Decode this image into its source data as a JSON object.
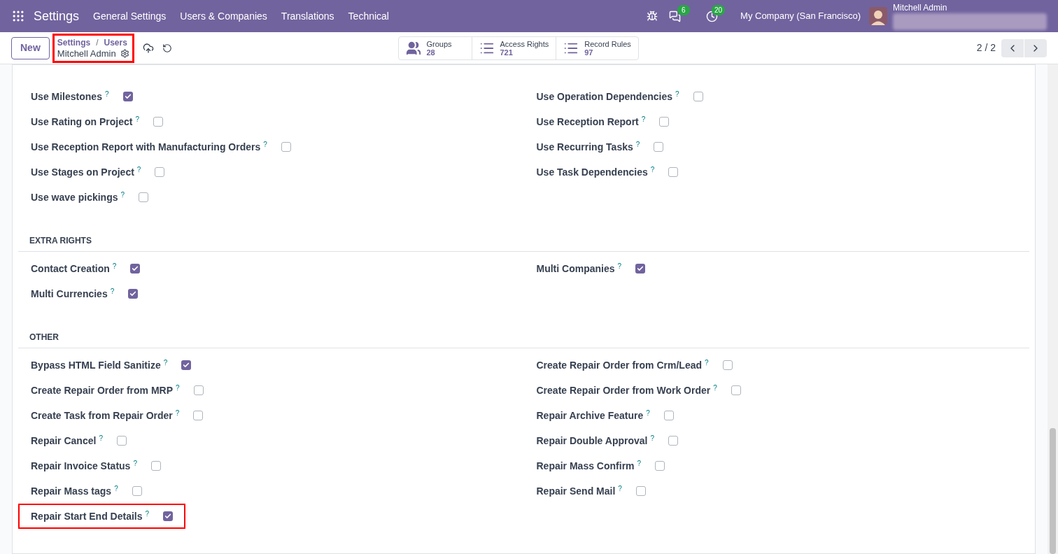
{
  "navbar": {
    "app": "Settings",
    "menus": [
      "General Settings",
      "Users & Companies",
      "Translations",
      "Technical"
    ],
    "messages_count": "6",
    "activities_count": "20",
    "company": "My Company (San Francisco)",
    "user": "Mitchell Admin"
  },
  "control_panel": {
    "new_button": "New",
    "breadcrumb": [
      "Settings",
      "Users"
    ],
    "breadcrumb_separator": "/",
    "record": "Mitchell Admin",
    "highlighted": true,
    "stats": [
      {
        "kind": "groups",
        "label": "Groups",
        "value": "28"
      },
      {
        "kind": "list",
        "label": "Access Rights",
        "value": "721"
      },
      {
        "kind": "list",
        "label": "Record Rules",
        "value": "97"
      }
    ],
    "pager": "2 / 2"
  },
  "sections": [
    {
      "left": [
        {
          "label": "Use Milestones",
          "help": "?",
          "checked": true,
          "highlighted": false
        },
        {
          "label": "Use Rating on Project",
          "help": "?",
          "checked": false,
          "highlighted": false
        },
        {
          "label": "Use Reception Report with Manufacturing Orders",
          "help": "?",
          "checked": false,
          "highlighted": false
        },
        {
          "label": "Use Stages on Project",
          "help": "?",
          "checked": false,
          "highlighted": false
        },
        {
          "label": "Use wave pickings",
          "help": "?",
          "checked": false,
          "highlighted": false
        }
      ],
      "right": [
        {
          "label": "Use Operation Dependencies",
          "help": "?",
          "checked": false,
          "highlighted": false
        },
        {
          "label": "Use Reception Report",
          "help": "?",
          "checked": false,
          "highlighted": false
        },
        {
          "label": "Use Recurring Tasks",
          "help": "?",
          "checked": false,
          "highlighted": false
        },
        {
          "label": "Use Task Dependencies",
          "help": "?",
          "checked": false,
          "highlighted": false
        }
      ]
    },
    {
      "title": "EXTRA RIGHTS",
      "left": [
        {
          "label": "Contact Creation",
          "help": "?",
          "checked": true,
          "highlighted": false
        },
        {
          "label": "Multi Currencies",
          "help": "?",
          "checked": true,
          "highlighted": false
        }
      ],
      "right": [
        {
          "label": "Multi Companies",
          "help": "?",
          "checked": true,
          "highlighted": false
        }
      ]
    },
    {
      "title": "OTHER",
      "left": [
        {
          "label": "Bypass HTML Field Sanitize",
          "help": "?",
          "checked": true,
          "highlighted": false
        },
        {
          "label": "Create Repair Order from MRP",
          "help": "?",
          "checked": false,
          "highlighted": false
        },
        {
          "label": "Create Task from Repair Order",
          "help": "?",
          "checked": false,
          "highlighted": false
        },
        {
          "label": "Repair Cancel",
          "help": "?",
          "checked": false,
          "highlighted": false
        },
        {
          "label": "Repair Invoice Status",
          "help": "?",
          "checked": false,
          "highlighted": false
        },
        {
          "label": "Repair Mass tags",
          "help": "?",
          "checked": false,
          "highlighted": false
        },
        {
          "label": "Repair Start End Details",
          "help": "?",
          "checked": true,
          "highlighted": true
        }
      ],
      "right": [
        {
          "label": "Create Repair Order from Crm/Lead",
          "help": "?",
          "checked": false,
          "highlighted": false
        },
        {
          "label": "Create Repair Order from Work Order",
          "help": "?",
          "checked": false,
          "highlighted": false
        },
        {
          "label": "Repair Archive Feature",
          "help": "?",
          "checked": false,
          "highlighted": false
        },
        {
          "label": "Repair Double Approval",
          "help": "?",
          "checked": false,
          "highlighted": false
        },
        {
          "label": "Repair Mass Confirm",
          "help": "?",
          "checked": false,
          "highlighted": false
        },
        {
          "label": "Repair Send Mail",
          "help": "?",
          "checked": false,
          "highlighted": false
        }
      ]
    }
  ]
}
